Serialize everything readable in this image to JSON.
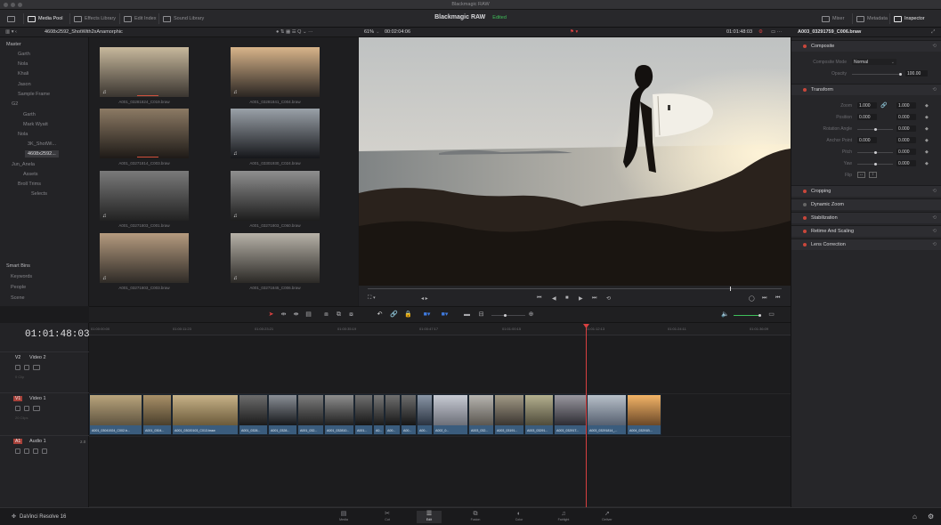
{
  "window": {
    "title": "Blackmagic RAW"
  },
  "toolbar": {
    "media_pool": "Media Pool",
    "effects_library": "Effects Library",
    "edit_index": "Edit Index",
    "sound_library": "Sound Library",
    "clip_title": "Blackmagic RAW",
    "clip_status": "Edited",
    "mixer": "Mixer",
    "metadata": "Metadata",
    "inspector": "Inspector"
  },
  "subbar": {
    "bin_path": "4608x2592_ShotWith2xAnamorphic",
    "zoom": "61%",
    "source_tc": "00:02:04:06",
    "record_tc": "01:01:48:03",
    "inspector_clip": "A003_03291759_C006.braw"
  },
  "bins": {
    "items": [
      {
        "label": "Master"
      },
      {
        "label": "Garth"
      },
      {
        "label": "Nola"
      },
      {
        "label": "Khali"
      },
      {
        "label": "Jason"
      },
      {
        "label": "Sample Frame"
      },
      {
        "label": "G2"
      },
      {
        "label": "Garth"
      },
      {
        "label": "Mark Wyatt"
      },
      {
        "label": "Nola"
      },
      {
        "label": "3K_ShotWi..."
      },
      {
        "label": "4608x2592..."
      },
      {
        "label": "Jun_Anela"
      },
      {
        "label": "Assets"
      },
      {
        "label": "Broll Trims"
      },
      {
        "label": "Selects"
      }
    ],
    "smart_bins": "Smart Bins",
    "smart_items": [
      {
        "label": "Keywords"
      },
      {
        "label": "People"
      },
      {
        "label": "Scene"
      }
    ]
  },
  "media": {
    "clips": [
      {
        "name": "A001_03281824_C019.braw",
        "c1": "#c7b89c",
        "c2": "#3a3530"
      },
      {
        "name": "A001_03281841_C004.braw",
        "c1": "#d8b48a",
        "c2": "#2a2522"
      },
      {
        "name": "A001_03271814_C003.braw",
        "c1": "#8c7a64",
        "c2": "#1e1a17"
      },
      {
        "name": "A001_03301930_C024.braw",
        "c1": "#9aa1a8",
        "c2": "#15161a"
      },
      {
        "name": "A001_03271803_C001.braw",
        "c1": "#7a7a7a",
        "c2": "#222"
      },
      {
        "name": "A001_03271803_C060.braw",
        "c1": "#8f8f8f",
        "c2": "#1d1d1d"
      },
      {
        "name": "A001_03271803_C003.braw",
        "c1": "#b59b7f",
        "c2": "#2f2b27"
      },
      {
        "name": "A001_03271845_C006.braw",
        "c1": "#b7b2a8",
        "c2": "#2b2926"
      }
    ],
    "note": "♫"
  },
  "viewer": {
    "left_ctrl": "⛶ ▾",
    "jog": "◂ ▸",
    "transport": [
      "⏮",
      "◀",
      "■",
      "▶",
      "⏭",
      "⟲"
    ],
    "right_ctrl": [
      "◯",
      "⏭",
      "⏮"
    ]
  },
  "inspector": {
    "composite": {
      "label": "Composite",
      "mode_label": "Composite Mode",
      "mode_value": "Normal",
      "opacity_label": "Opacity",
      "opacity_value": "100.00"
    },
    "transform": {
      "label": "Transform",
      "zoom_label": "Zoom",
      "zoom_x": "1.000",
      "zoom_y": "1.000",
      "position_label": "Position",
      "position_x": "0.000",
      "position_y": "0.000",
      "rotation_label": "Rotation Angle",
      "rotation_value": "0.000",
      "anchor_label": "Anchor Point",
      "anchor_x": "0.000",
      "anchor_y": "0.000",
      "pitch_label": "Pitch",
      "pitch_value": "0.000",
      "yaw_label": "Yaw",
      "yaw_value": "0.000",
      "flip_label": "Flip"
    },
    "sections": [
      {
        "label": "Cropping"
      },
      {
        "label": "Dynamic Zoom"
      },
      {
        "label": "Stabilization"
      },
      {
        "label": "Retime And Scaling"
      },
      {
        "label": "Lens Correction"
      }
    ]
  },
  "timeline": {
    "timecode": "01:01:48:03",
    "ruler": [
      "01:00:00:00",
      "01:00:11:23",
      "01:00:23:21",
      "01:00:35:19",
      "01:00:47:17",
      "01:01:00:15",
      "01:01:12:13",
      "01:01:24:11",
      "01:01:36:09",
      "01:01:48:07"
    ],
    "tracks": {
      "v2": {
        "id": "V2",
        "name": "Video 2",
        "count": "0 Clip"
      },
      "v1": {
        "id": "V1",
        "name": "Video 1",
        "count": "20 Clips"
      },
      "a1": {
        "id": "A1",
        "name": "Audio 1",
        "level": "2.0"
      }
    },
    "clips": [
      {
        "name": "A001_03041924_C002.b...",
        "c1": "#b9a47c",
        "c2": "#5f5440"
      },
      {
        "name": "A001_0304...",
        "c1": "#a99068",
        "c2": "#4a3f2c"
      },
      {
        "name": "A001_03020103_C013.braw",
        "c1": "#c7b288",
        "c2": "#6b5a3a"
      },
      {
        "name": "A001_0328...",
        "c1": "#6c6c6c",
        "c2": "#1b1b1b"
      },
      {
        "name": "A001_0328...",
        "c1": "#8a8f96",
        "c2": "#16181b"
      },
      {
        "name": "A001_032...",
        "c1": "#7d7d7d",
        "c2": "#202020"
      },
      {
        "name": "A001_032810...",
        "c1": "#8e8e8e",
        "c2": "#1f1f1f"
      },
      {
        "name": "A001...",
        "c1": "#707070",
        "c2": "#161616"
      },
      {
        "name": "A0...",
        "c1": "#777",
        "c2": "#1a1a1a"
      },
      {
        "name": "A00...",
        "c1": "#6f6f6f",
        "c2": "#171717"
      },
      {
        "name": "A00...",
        "c1": "#6d6d6d",
        "c2": "#151515"
      },
      {
        "name": "A00...",
        "c1": "#8a96a6",
        "c2": "#2a3340"
      },
      {
        "name": "A002_0...",
        "c1": "#c8cbd4",
        "c2": "#6c6f78"
      },
      {
        "name": "A003_032...",
        "c1": "#b7b5b0",
        "c2": "#5a5650"
      },
      {
        "name": "A003_03191...",
        "c1": "#a29a86",
        "c2": "#3a3530"
      },
      {
        "name": "A003_03291...",
        "c1": "#b4b08f",
        "c2": "#4f4b3a"
      },
      {
        "name": "A003_03291T...",
        "c1": "#9a98a0",
        "c2": "#2d2c33"
      },
      {
        "name": "A003_03291814_...",
        "c1": "#b8c0c9",
        "c2": "#566070"
      },
      {
        "name": "A004_03291B...",
        "c1": "#f3b467",
        "c2": "#6b4828"
      }
    ]
  },
  "pages": [
    {
      "label": "Media",
      "glyph": "▤"
    },
    {
      "label": "Cut",
      "glyph": "✂"
    },
    {
      "label": "Edit",
      "glyph": "☰"
    },
    {
      "label": "Fusion",
      "glyph": "⧉"
    },
    {
      "label": "Color",
      "glyph": "◐"
    },
    {
      "label": "Fairlight",
      "glyph": "♫"
    },
    {
      "label": "Deliver",
      "glyph": "➚"
    }
  ],
  "app_name": "DaVinci Resolve 16",
  "colors": {
    "accent_red": "#d84040",
    "clip_blue": "#3a5c7d",
    "status_green": "#3fbf5a"
  }
}
